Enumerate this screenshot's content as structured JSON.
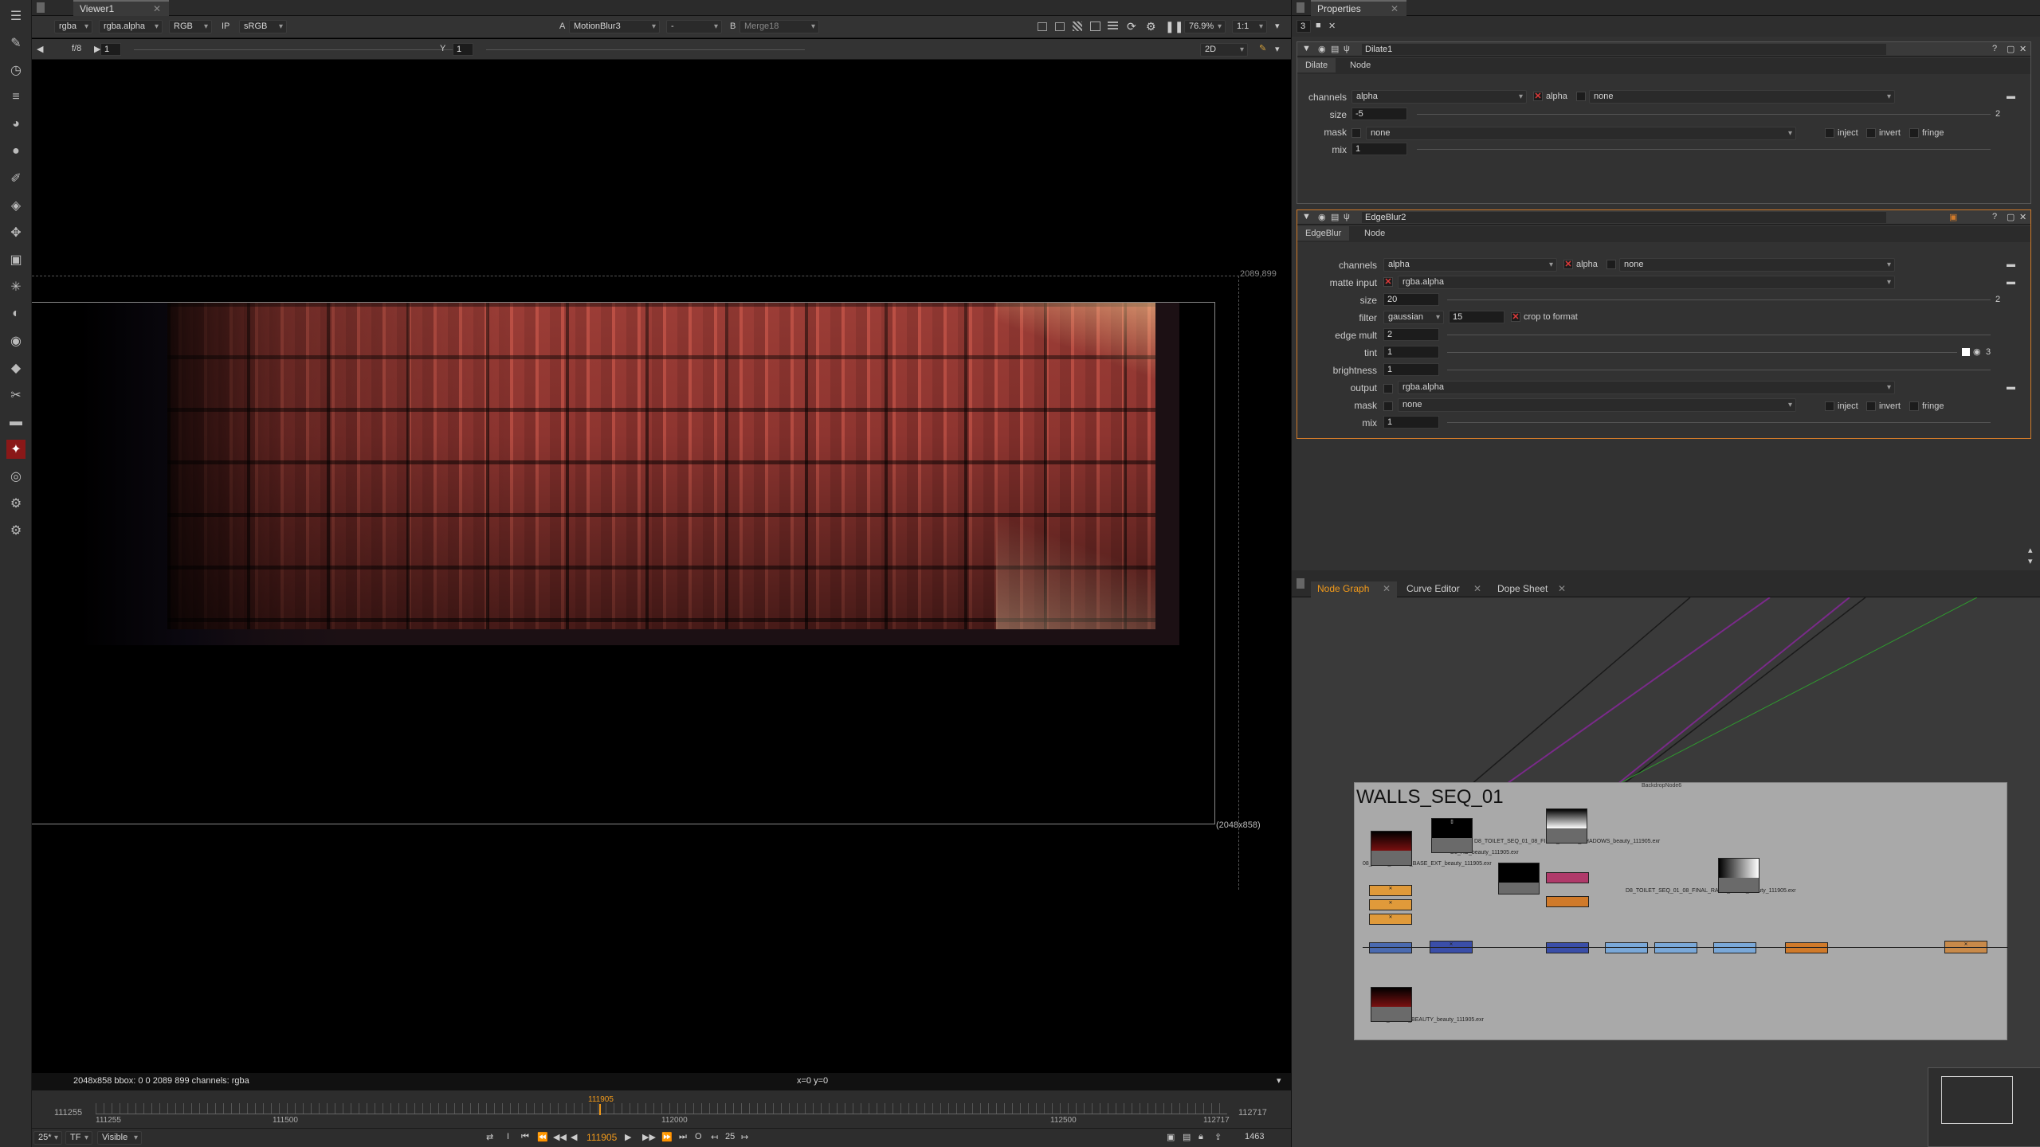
{
  "viewer": {
    "tab_title": "Viewer1",
    "channels": "rgba",
    "channel_alpha": "rgba.alpha",
    "display_channels": "RGB",
    "ip_label": "IP",
    "lut": "sRGB",
    "input_a_label": "A",
    "input_a": "MotionBlur3",
    "input_a_op": "-",
    "input_b_label": "B",
    "input_b": "Merge18",
    "zoom": "76.9%",
    "ratio": "1:1",
    "fstop": "f/8",
    "frame_step": "1",
    "y_label": "Y",
    "y_value": "1",
    "view_mode": "2D",
    "bbox_top_right": "2089,899",
    "format_bottom_right": "(2048x858)",
    "status_info": "2048x858  bbox: 0 0 2089 899 channels: rgba",
    "cursor_pos": "x=0 y=0"
  },
  "timeline": {
    "start": "111255",
    "end": "112717",
    "in_mark": "111255",
    "ticks": [
      "111500",
      "112000",
      "112500"
    ],
    "out_mark": "112717",
    "current": "111905",
    "fps": "25*",
    "tf": "TF",
    "visible": "Visible",
    "frame_display": "111905",
    "increment": "25",
    "total": "1463"
  },
  "properties": {
    "tab_title": "Properties",
    "max_panels": "3",
    "dilate": {
      "name": "Dilate1",
      "tabs": [
        "Dilate",
        "Node"
      ],
      "channels_label": "channels",
      "channels": "alpha",
      "alpha_label": "alpha",
      "none_label": "none",
      "size_label": "size",
      "size": "-5",
      "size_count": "2",
      "mask_label": "mask",
      "mask": "none",
      "inject": "inject",
      "invert": "invert",
      "fringe": "fringe",
      "mix_label": "mix",
      "mix": "1"
    },
    "edgeblur": {
      "name": "EdgeBlur2",
      "tabs": [
        "EdgeBlur",
        "Node"
      ],
      "channels_label": "channels",
      "channels": "alpha",
      "alpha_label": "alpha",
      "none_label": "none",
      "matte_label": "matte input",
      "matte": "rgba.alpha",
      "size_label": "size",
      "size": "20",
      "size_count": "2",
      "filter_label": "filter",
      "filter": "gaussian",
      "filter_value": "15",
      "crop_label": "crop to format",
      "edge_mult_label": "edge mult",
      "edge_mult": "2",
      "tint_label": "tint",
      "tint": "1",
      "tint_count": "3",
      "brightness_label": "brightness",
      "brightness": "1",
      "output_label": "output",
      "output": "rgba.alpha",
      "mask_label": "mask",
      "mask": "none",
      "inject": "inject",
      "invert": "invert",
      "fringe": "fringe",
      "mix_label": "mix",
      "mix": "1"
    }
  },
  "nodegraph": {
    "tabs": [
      "Node Graph",
      "Curve Editor",
      "Dope Sheet"
    ],
    "backdrop_title": "WALLS_SEQ_01",
    "backdrop_sub": "BackdropNode6",
    "labels": [
      "D8_TOILET_SEQ_01_08_FINAL_WALLS_SHADOWS_beauty_111905.exr",
      "08_FINAL_WALLS_BASE_EXT_beauty_111905.exr",
      "D8_AO_beauty_111905.exr",
      "D8_TOILET_SEQ_01_08_FINAL_RAMP_MASK_beauty_111905.exr",
      "FINAL_WALLS_BEAUTY_beauty_111905.exr"
    ]
  }
}
